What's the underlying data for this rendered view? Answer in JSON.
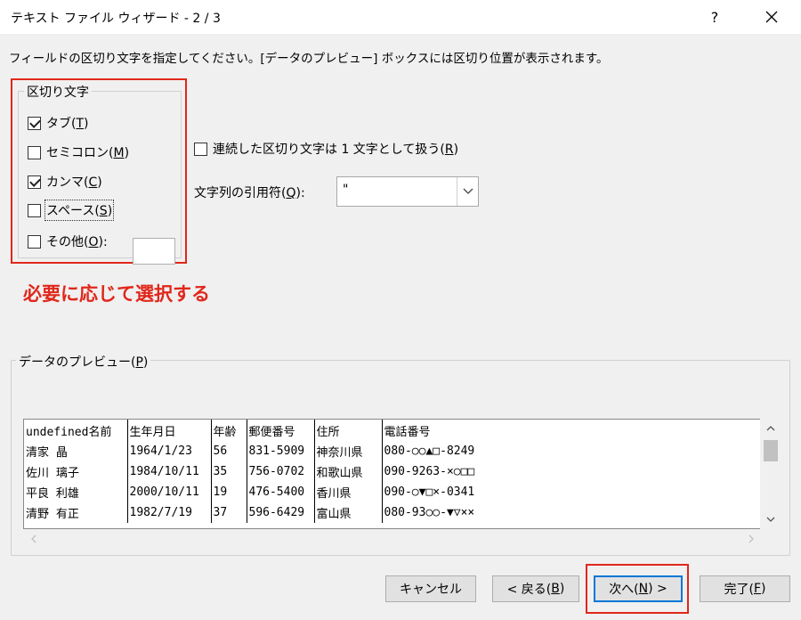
{
  "window": {
    "title": "テキスト ファイル ウィザード - 2 / 3",
    "help_label": "?",
    "close_icon": "close-icon"
  },
  "instruction": "フィールドの区切り文字を指定してください。[データのプレビュー] ボックスには区切り位置が表示されます。",
  "delimiters": {
    "legend": "区切り文字",
    "tab": {
      "label": "タブ(",
      "key": "T",
      "end": ")",
      "checked": true
    },
    "semicolon": {
      "label": "セミコロン(",
      "key": "M",
      "end": ")",
      "checked": false
    },
    "comma": {
      "label": "カンマ(",
      "key": "C",
      "end": ")",
      "checked": true
    },
    "space": {
      "label": "スペース(",
      "key": "S",
      "end": ")",
      "checked": false
    },
    "other": {
      "label": "その他(",
      "key": "O",
      "end": "):",
      "checked": false,
      "value": ""
    }
  },
  "consecutive": {
    "label": "連続した区切り文字は 1 文字として扱う(",
    "key": "R",
    "end": ")",
    "checked": false
  },
  "text_qualifier": {
    "label": "文字列の引用符(",
    "key": "Q",
    "end": "):",
    "value": "\""
  },
  "annotation": "必要に応じて選択する",
  "preview": {
    "legend": "データのプレビュー(",
    "key": "P",
    "end": ")",
    "rows": [
      [
        "undefined名前",
        "生年月日",
        "年齢",
        "郵便番号",
        "住所",
        "電話番号"
      ],
      [
        "清家 晶",
        "1964/1/23",
        "56",
        "831-5909",
        "神奈川県",
        "080-○○▲□-8249"
      ],
      [
        "佐川 璃子",
        "1984/10/11",
        "35",
        "756-0702",
        "和歌山県",
        "090-9263-×○□□"
      ],
      [
        "平良 利雄",
        "2000/10/11",
        "19",
        "476-5400",
        "香川県",
        "090-○▼□×-0341"
      ],
      [
        "清野 有正",
        "1982/7/19",
        "37",
        "596-6429",
        "富山県",
        "080-93○○-▼▽××"
      ]
    ]
  },
  "buttons": {
    "cancel": {
      "label": "キャンセル"
    },
    "back": {
      "label": "< 戻る(",
      "key": "B",
      "end": ")"
    },
    "next": {
      "label": "次へ(",
      "key": "N",
      "end": ") >"
    },
    "finish": {
      "label": "完了(",
      "key": "F",
      "end": ")"
    }
  },
  "colors": {
    "annotation": "#e0271b",
    "primary_border": "#0078d7"
  }
}
